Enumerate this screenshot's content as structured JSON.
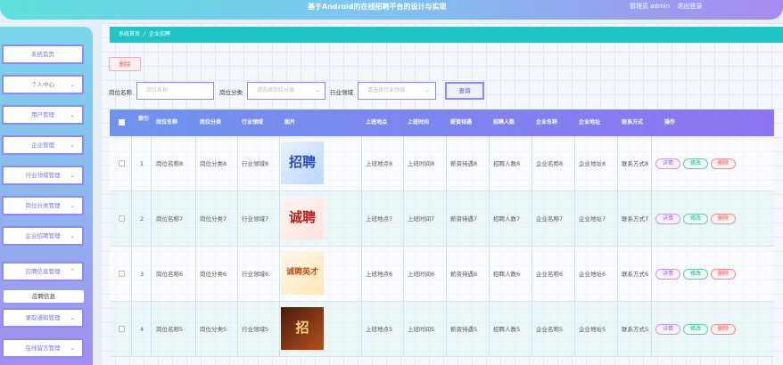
{
  "header": {
    "title": "基于Android的在线招聘平台的设计与实现",
    "user_label": "管理员 admin",
    "logout_label": "退出登录"
  },
  "sidebar": {
    "items": [
      {
        "label": "系统首页",
        "has_chevron": false
      },
      {
        "label": "个人中心",
        "has_chevron": true
      },
      {
        "label": "用户管理",
        "has_chevron": true
      },
      {
        "label": "企业管理",
        "has_chevron": true
      },
      {
        "label": "行业领域管理",
        "has_chevron": true
      },
      {
        "label": "岗位分类管理",
        "has_chevron": true
      },
      {
        "label": "企业招聘管理",
        "has_chevron": true
      },
      {
        "label": "应聘信息管理",
        "has_chevron": true,
        "expanded": true
      },
      {
        "label": "录取通知管理",
        "has_chevron": true
      },
      {
        "label": "在线留言管理",
        "has_chevron": true
      }
    ],
    "submenu": {
      "label": "应聘信息"
    }
  },
  "breadcrumb": {
    "home": "系统首页",
    "separator": "/",
    "current": "企业招聘"
  },
  "toolbar": {
    "delete_label": "删除"
  },
  "search": {
    "position_label": "岗位名称",
    "position_placeholder": "岗位名称",
    "category_label": "岗位分类",
    "category_placeholder": "请选择岗位分类",
    "industry_label": "行业领域",
    "industry_placeholder": "请选择行业领域",
    "search_button": "查询"
  },
  "table": {
    "columns": [
      "索引",
      "岗位名称",
      "岗位分类",
      "行业领域",
      "图片",
      "上班地点",
      "上班时间",
      "薪资待遇",
      "招聘人数",
      "企业名称",
      "企业地址",
      "联系方式",
      "操作"
    ],
    "actions": {
      "detail": "详情",
      "edit": "修改",
      "delete": "删除"
    },
    "rows": [
      {
        "index": "1",
        "name": "岗位名称8",
        "category": "岗位分类8",
        "industry": "行业领域8",
        "image_text": "招聘",
        "image_theme": "blue",
        "location": "上班地点8",
        "time": "上班时间8",
        "salary": "薪资待遇8",
        "count": "招聘人数8",
        "company": "企业名称8",
        "address": "企业地址8",
        "contact": "联系方式8"
      },
      {
        "index": "2",
        "name": "岗位名称7",
        "category": "岗位分类7",
        "industry": "行业领域7",
        "image_text": "诚聘",
        "image_theme": "red",
        "location": "上班地点7",
        "time": "上班时间7",
        "salary": "薪资待遇7",
        "count": "招聘人数7",
        "company": "企业名称7",
        "address": "企业地址7",
        "contact": "联系方式7"
      },
      {
        "index": "3",
        "name": "岗位名称6",
        "category": "岗位分类6",
        "industry": "行业领域6",
        "image_text": "诚聘英才",
        "image_theme": "orange",
        "location": "上班地点6",
        "time": "上班时间6",
        "salary": "薪资待遇6",
        "count": "招聘人数6",
        "company": "企业名称6",
        "address": "企业地址6",
        "contact": "联系方式6"
      },
      {
        "index": "4",
        "name": "岗位名称5",
        "category": "岗位分类5",
        "industry": "行业领域5",
        "image_text": "招",
        "image_theme": "brown",
        "location": "上班地点5",
        "time": "上班时间5",
        "salary": "薪资待遇5",
        "count": "招聘人数5",
        "company": "企业名称5",
        "address": "企业地址5",
        "contact": "联系方式5"
      }
    ]
  }
}
